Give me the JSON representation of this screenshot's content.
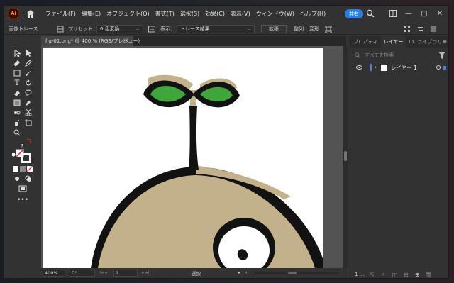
{
  "app": {
    "logo": "Ai",
    "menu": [
      "ファイル(F)",
      "編集(E)",
      "オブジェクト(O)",
      "書式(T)",
      "選択(S)",
      "効果(C)",
      "表示(V)",
      "ウィンドウ(W)",
      "ヘルプ(H)"
    ],
    "share_label": "共有",
    "window_controls": [
      "—",
      "▢",
      "✕"
    ]
  },
  "controlbar": {
    "title": "画像トレース",
    "preset_label": "プリセット：",
    "preset_value": "6 色変換",
    "view_label": "表示：",
    "view_value": "トレース結果",
    "expand_label": "拡張",
    "align_label": "整列",
    "transform_label": "変形"
  },
  "document": {
    "tab_title": "fig-01.png* @ 400 % (RGB/プレビュー)",
    "close_icon": "×"
  },
  "statusbar": {
    "zoom": "400%",
    "rotation": "0°",
    "artboard_num": "1",
    "status_text": "選択"
  },
  "panel": {
    "tabs": [
      "プロパティ",
      "レイヤー",
      "CC ライブラリ"
    ],
    "active_tab": 1,
    "search_placeholder": "すべてを検索",
    "layer_name": "レイヤー 1",
    "layer_color": "#4f7ee6",
    "footer_count": "1 ..."
  },
  "colors": {
    "accent": "#2680eb",
    "logo_orange": "#ff9a00",
    "leaf_green": "#3fa63a",
    "body_tan": "#c2b18a",
    "outline": "#121212"
  }
}
